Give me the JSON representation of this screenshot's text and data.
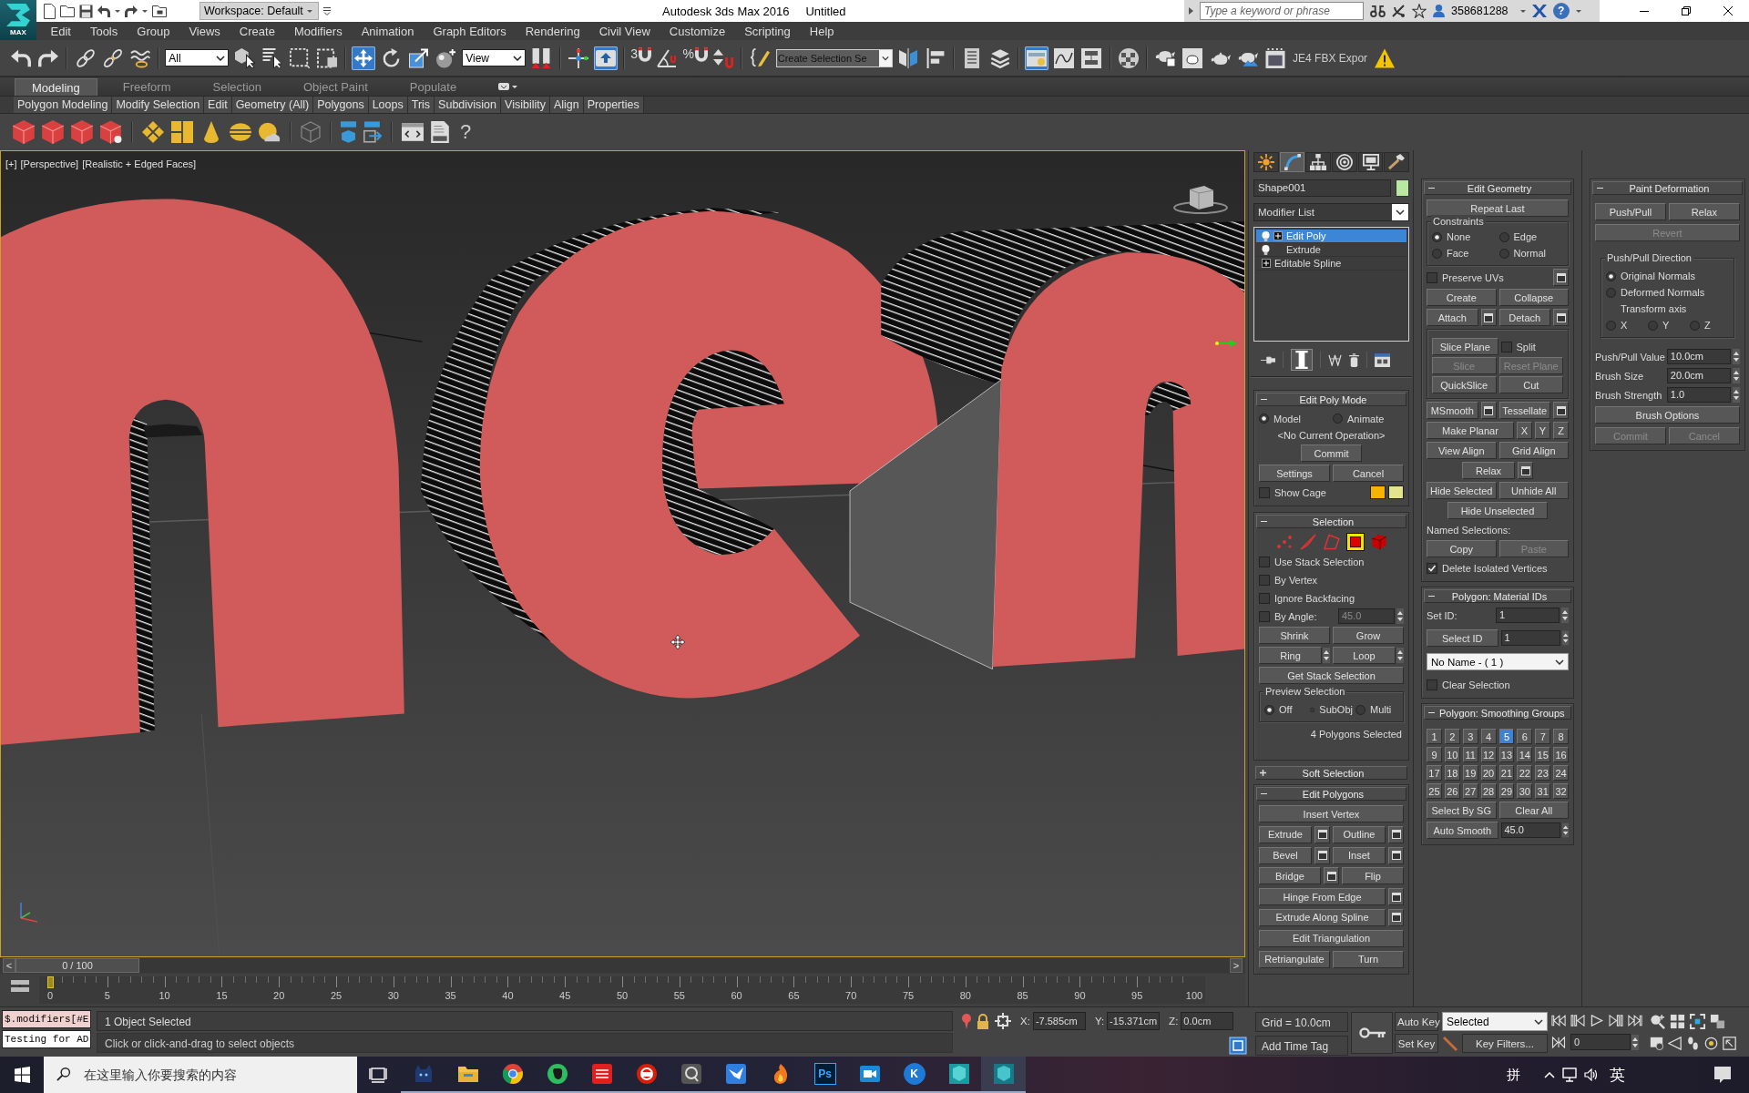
{
  "title_bar": {
    "app_button": "MAX",
    "workspace": "Workspace: Default",
    "title": "Autodesk 3ds Max 2016",
    "document": "Untitled",
    "search": {
      "placeholder": "Type a keyword or phrase"
    },
    "user": "358681288",
    "help": "?"
  },
  "menu_bar": [
    "Edit",
    "Tools",
    "Group",
    "Views",
    "Create",
    "Modifiers",
    "Animation",
    "Graph Editors",
    "Rendering",
    "Civil View",
    "Customize",
    "Scripting",
    "Help"
  ],
  "main_toolbar": {
    "selection_filter": "All",
    "reference_coordinate_system": "View",
    "snaps_toggle": "3",
    "percent_snap": "%",
    "named_selection_set": {
      "placeholder": "Create Selection Se"
    },
    "plugin": "JE4 FBX Expor",
    "pressed": {
      "select_object": false,
      "select_and_move": true,
      "select_and_rotate": false,
      "select_and_scale": false,
      "keyboard_shortcut_override": true,
      "toggle_ribbon": true
    }
  },
  "ribbon": {
    "tabs": [
      {
        "label": "Modeling",
        "selected": true
      },
      {
        "label": "Freeform",
        "selected": false
      },
      {
        "label": "Selection",
        "selected": false
      },
      {
        "label": "Object Paint",
        "selected": false
      },
      {
        "label": "Populate",
        "selected": false
      }
    ],
    "panels": [
      "Polygon Modeling",
      "Modify Selection",
      "Edit",
      "Geometry (All)",
      "Polygons",
      "Loops",
      "Tris",
      "Subdivision",
      "Visibility",
      "Align",
      "Properties"
    ],
    "help": "?"
  },
  "viewport": {
    "labels": [
      "[+]",
      "[Perspective]",
      "[Realistic + Edged Faces]"
    ],
    "active": true
  },
  "command_panel": {
    "tabs": [
      {
        "selected": false
      },
      {
        "selected": true
      },
      {
        "selected": false
      },
      {
        "selected": false
      },
      {
        "selected": false
      },
      {
        "selected": false
      }
    ],
    "object_name": "Shape001",
    "modifier_list": "Modifier List",
    "stack": [
      {
        "label": "Edit Poly",
        "kind": "modifier",
        "expanded": false,
        "selected": true
      },
      {
        "label": "Extrude",
        "kind": "modifier",
        "selected": false
      },
      {
        "label": "Editable Spline",
        "kind": "base",
        "expanded": false,
        "selected": false
      }
    ],
    "show_end_result": true,
    "columns": [
      [
        {
          "title": "Edit Poly Mode",
          "expanded": true,
          "rows": [
            [
              {
                "kind": "radio",
                "label": "Model",
                "selected": true
              },
              {
                "kind": "radio",
                "label": "Animate",
                "selected": false
              }
            ],
            [
              {
                "kind": "note",
                "text": "<No Current Operation>"
              }
            ],
            [
              {
                "kind": "short_button",
                "label": "Commit",
                "disabled": false
              }
            ],
            [
              {
                "kind": "button",
                "label": "Settings",
                "disabled": false
              },
              {
                "kind": "button",
                "label": "Cancel",
                "disabled": false
              }
            ],
            [
              {
                "kind": "checkbox",
                "label": "Show Cage",
                "checked": false
              },
              {
                "kind": "swatch",
                "color": "#f5b400"
              },
              {
                "kind": "swatch",
                "color": "#e3e48e"
              }
            ]
          ]
        },
        {
          "title": "Selection",
          "expanded": true,
          "rows": [
            [
              {
                "kind": "subobject",
                "selected": false
              },
              {
                "kind": "subobject",
                "selected": false
              },
              {
                "kind": "subobject",
                "selected": false
              },
              {
                "kind": "subobject",
                "selected": true
              },
              {
                "kind": "subobject",
                "selected": false
              }
            ],
            [
              {
                "kind": "checkbox",
                "label": "Use Stack Selection",
                "checked": false
              }
            ],
            [
              {
                "kind": "checkbox",
                "label": "By Vertex",
                "checked": false
              }
            ],
            [
              {
                "kind": "checkbox",
                "label": "Ignore Backfacing",
                "checked": false
              }
            ],
            [
              {
                "kind": "checkbox",
                "label": "By Angle:",
                "checked": false,
                "value": "45.0",
                "disabled": true
              }
            ],
            [
              {
                "kind": "button",
                "label": "Shrink",
                "disabled": false
              },
              {
                "kind": "button",
                "label": "Grow",
                "disabled": false
              }
            ],
            [
              {
                "kind": "stepper",
                "label": "Ring",
                "disabled": false
              },
              {
                "kind": "stepper",
                "label": "Loop",
                "disabled": false
              }
            ],
            [
              {
                "kind": "button",
                "label": "Get Stack Selection",
                "disabled": false
              }
            ],
            [
              {
                "kind": "group",
                "title": "Preview Selection",
                "rows": [
                  [
                    {
                      "kind": "radio",
                      "label": "Off",
                      "selected": true
                    },
                    {
                      "kind": "radio",
                      "label": "SubObj",
                      "selected": false
                    },
                    {
                      "kind": "radio",
                      "label": "Multi",
                      "selected": false
                    }
                  ]
                ]
              }
            ],
            [
              {
                "kind": "status",
                "text": "4 Polygons Selected"
              }
            ]
          ]
        },
        {
          "title": "Soft Selection",
          "expanded": false
        },
        {
          "title": "Edit Polygons",
          "expanded": true,
          "rows": [
            [
              {
                "kind": "button",
                "label": "Insert Vertex",
                "disabled": false
              }
            ],
            [
              {
                "kind": "button",
                "label": "Extrude",
                "disabled": false
              },
              {
                "kind": "settings",
                "disabled": false
              },
              {
                "kind": "button",
                "label": "Outline",
                "disabled": false
              },
              {
                "kind": "settings",
                "disabled": false
              }
            ],
            [
              {
                "kind": "button",
                "label": "Bevel",
                "disabled": false
              },
              {
                "kind": "settings",
                "disabled": false
              },
              {
                "kind": "button",
                "label": "Inset",
                "disabled": false
              },
              {
                "kind": "settings",
                "disabled": false
              }
            ],
            [
              {
                "kind": "button",
                "label": "Bridge",
                "disabled": false
              },
              {
                "kind": "settings",
                "disabled": false
              },
              {
                "kind": "button",
                "label": "Flip",
                "disabled": false
              }
            ],
            [
              {
                "kind": "button",
                "label": "Hinge From Edge",
                "disabled": false
              },
              {
                "kind": "settings",
                "disabled": false
              }
            ],
            [
              {
                "kind": "button",
                "label": "Extrude Along Spline",
                "disabled": false
              },
              {
                "kind": "settings",
                "disabled": false
              }
            ],
            [
              {
                "kind": "button",
                "label": "Edit Triangulation",
                "disabled": false
              }
            ],
            [
              {
                "kind": "button",
                "label": "Retriangulate",
                "disabled": false
              },
              {
                "kind": "button",
                "label": "Turn",
                "disabled": false
              }
            ]
          ]
        }
      ],
      [
        {
          "title": "Edit Geometry",
          "expanded": true,
          "rows": [
            [
              {
                "kind": "button",
                "label": "Repeat Last",
                "disabled": false
              }
            ],
            [
              {
                "kind": "group",
                "title": "Constraints",
                "rows": [
                  [
                    {
                      "kind": "radio",
                      "label": "None",
                      "selected": true
                    },
                    {
                      "kind": "radio",
                      "label": "Edge",
                      "selected": false
                    }
                  ],
                  [
                    {
                      "kind": "radio",
                      "label": "Face",
                      "selected": false
                    },
                    {
                      "kind": "radio",
                      "label": "Normal",
                      "selected": false
                    }
                  ]
                ]
              }
            ],
            [
              {
                "kind": "checkbox",
                "label": "Preserve UVs",
                "checked": false
              },
              {
                "kind": "settings",
                "disabled": false
              }
            ],
            [
              {
                "kind": "button",
                "label": "Create",
                "disabled": false
              },
              {
                "kind": "button",
                "label": "Collapse",
                "disabled": false
              }
            ],
            [
              {
                "kind": "button",
                "label": "Attach",
                "disabled": false
              },
              {
                "kind": "settings",
                "disabled": false
              },
              {
                "kind": "button",
                "label": "Detach",
                "disabled": false
              },
              {
                "kind": "settings",
                "disabled": false
              }
            ],
            [
              {
                "kind": "group",
                "rows": [
                  [
                    {
                      "kind": "button",
                      "label": "Slice Plane",
                      "disabled": false
                    },
                    {
                      "kind": "checkbox",
                      "label": "Split",
                      "checked": false
                    }
                  ],
                  [
                    {
                      "kind": "button",
                      "label": "Slice",
                      "disabled": true
                    },
                    {
                      "kind": "button",
                      "label": "Reset Plane",
                      "disabled": true
                    }
                  ],
                  [
                    {
                      "kind": "button",
                      "label": "QuickSlice",
                      "disabled": false
                    },
                    {
                      "kind": "button",
                      "label": "Cut",
                      "disabled": false
                    }
                  ]
                ]
              }
            ],
            [
              {
                "kind": "button",
                "label": "MSmooth",
                "disabled": false
              },
              {
                "kind": "settings",
                "disabled": false
              },
              {
                "kind": "button",
                "label": "Tessellate",
                "disabled": false
              },
              {
                "kind": "settings",
                "disabled": false
              }
            ],
            [
              {
                "kind": "button",
                "label": "Make Planar",
                "disabled": false
              },
              {
                "kind": "small_button",
                "label": "X",
                "disabled": false
              },
              {
                "kind": "small_button",
                "label": "Y",
                "disabled": false
              },
              {
                "kind": "small_button",
                "label": "Z",
                "disabled": false
              }
            ],
            [
              {
                "kind": "button",
                "label": "View Align",
                "disabled": false
              },
              {
                "kind": "button",
                "label": "Grid Align",
                "disabled": false
              }
            ],
            [
              {
                "kind": "short_button",
                "label": "Relax",
                "disabled": false
              },
              {
                "kind": "settings",
                "disabled": false
              }
            ],
            [
              {
                "kind": "button",
                "label": "Hide Selected",
                "disabled": false
              },
              {
                "kind": "button",
                "label": "Unhide All",
                "disabled": false
              }
            ],
            [
              {
                "kind": "short_button",
                "label": "Hide Unselected",
                "disabled": false
              }
            ],
            [
              {
                "kind": "caption",
                "text": "Named Selections:"
              }
            ],
            [
              {
                "kind": "button",
                "label": "Copy",
                "disabled": false
              },
              {
                "kind": "button",
                "label": "Paste",
                "disabled": true
              }
            ],
            [
              {
                "kind": "checkbox",
                "label": "Delete Isolated Vertices",
                "checked": true
              }
            ]
          ]
        },
        {
          "title": "Polygon: Material IDs",
          "expanded": true,
          "rows": [
            [
              {
                "kind": "spinner",
                "label": "Set ID:",
                "value": "1",
                "disabled": false
              }
            ],
            [
              {
                "kind": "button",
                "label": "Select ID",
                "disabled": false
              },
              {
                "kind": "spinner",
                "value": "1",
                "disabled": false
              }
            ],
            [
              {
                "kind": "dropdown",
                "value": "No Name - ( 1 )"
              }
            ],
            [
              {
                "kind": "checkbox",
                "label": "Clear Selection",
                "checked": false
              }
            ]
          ]
        },
        {
          "title": "Polygon: Smoothing Groups",
          "expanded": true,
          "rows": [
            [
              {
                "kind": "toggle",
                "label": "1",
                "selected": false
              },
              {
                "kind": "toggle",
                "label": "2",
                "selected": false
              },
              {
                "kind": "toggle",
                "label": "3",
                "selected": false
              },
              {
                "kind": "toggle",
                "label": "4",
                "selected": false
              },
              {
                "kind": "toggle",
                "label": "5",
                "selected": true
              },
              {
                "kind": "toggle",
                "label": "6",
                "selected": false
              },
              {
                "kind": "toggle",
                "label": "7",
                "selected": false
              },
              {
                "kind": "toggle",
                "label": "8",
                "selected": false
              }
            ],
            [
              {
                "kind": "toggle",
                "label": "9",
                "selected": false
              },
              {
                "kind": "toggle",
                "label": "10",
                "selected": false
              },
              {
                "kind": "toggle",
                "label": "11",
                "selected": false
              },
              {
                "kind": "toggle",
                "label": "12",
                "selected": false
              },
              {
                "kind": "toggle",
                "label": "13",
                "selected": false
              },
              {
                "kind": "toggle",
                "label": "14",
                "selected": false
              },
              {
                "kind": "toggle",
                "label": "15",
                "selected": false
              },
              {
                "kind": "toggle",
                "label": "16",
                "selected": false
              }
            ],
            [
              {
                "kind": "toggle",
                "label": "17",
                "selected": false
              },
              {
                "kind": "toggle",
                "label": "18",
                "selected": false
              },
              {
                "kind": "toggle",
                "label": "19",
                "selected": false
              },
              {
                "kind": "toggle",
                "label": "20",
                "selected": false
              },
              {
                "kind": "toggle",
                "label": "21",
                "selected": false
              },
              {
                "kind": "toggle",
                "label": "22",
                "selected": false
              },
              {
                "kind": "toggle",
                "label": "23",
                "selected": false
              },
              {
                "kind": "toggle",
                "label": "24",
                "selected": false
              }
            ],
            [
              {
                "kind": "toggle",
                "label": "25",
                "selected": false
              },
              {
                "kind": "toggle",
                "label": "26",
                "selected": false
              },
              {
                "kind": "toggle",
                "label": "27",
                "selected": false
              },
              {
                "kind": "toggle",
                "label": "28",
                "selected": false
              },
              {
                "kind": "toggle",
                "label": "29",
                "selected": false
              },
              {
                "kind": "toggle",
                "label": "30",
                "selected": false
              },
              {
                "kind": "toggle",
                "label": "31",
                "selected": false
              },
              {
                "kind": "toggle",
                "label": "32",
                "selected": false
              }
            ],
            [
              {
                "kind": "button",
                "label": "Select By SG",
                "disabled": false
              },
              {
                "kind": "button",
                "label": "Clear All",
                "disabled": false
              }
            ],
            [
              {
                "kind": "button",
                "label": "Auto Smooth",
                "disabled": false
              },
              {
                "kind": "spinner",
                "value": "45.0",
                "disabled": false
              }
            ]
          ]
        }
      ],
      [
        {
          "title": "Paint Deformation",
          "expanded": true,
          "rows": [
            [
              {
                "kind": "button",
                "label": "Push/Pull",
                "disabled": false
              },
              {
                "kind": "button",
                "label": "Relax",
                "disabled": false
              }
            ],
            [
              {
                "kind": "button",
                "label": "Revert",
                "disabled": true
              }
            ],
            [
              {
                "kind": "group",
                "title": "Push/Pull Direction",
                "rows": [
                  [
                    {
                      "kind": "radio",
                      "label": "Original Normals",
                      "selected": true
                    }
                  ],
                  [
                    {
                      "kind": "radio",
                      "label": "Deformed Normals",
                      "selected": false
                    }
                  ],
                  [
                    {
                      "kind": "caption",
                      "text": "Transform axis"
                    }
                  ],
                  [
                    {
                      "kind": "radio",
                      "label": "X",
                      "selected": false
                    },
                    {
                      "kind": "radio",
                      "label": "Y",
                      "selected": false
                    },
                    {
                      "kind": "radio",
                      "label": "Z",
                      "selected": false
                    }
                  ]
                ]
              }
            ],
            [
              {
                "kind": "spinner",
                "label": "Push/Pull Value",
                "value": "10.0cm",
                "disabled": false
              }
            ],
            [
              {
                "kind": "spinner",
                "label": "Brush Size",
                "value": "20.0cm",
                "disabled": false
              }
            ],
            [
              {
                "kind": "spinner",
                "label": "Brush Strength",
                "value": "1.0",
                "disabled": false
              }
            ],
            [
              {
                "kind": "button",
                "label": "Brush Options",
                "disabled": false
              }
            ],
            [
              {
                "kind": "button",
                "label": "Commit",
                "disabled": true
              },
              {
                "kind": "button",
                "label": "Cancel",
                "disabled": true
              }
            ]
          ]
        }
      ]
    ]
  },
  "time_slider": {
    "prev": "<",
    "label": "0 / 100",
    "next": ">",
    "level": 0
  },
  "track_bar": {
    "labels": [
      "0",
      "5",
      "10",
      "15",
      "20",
      "25",
      "30",
      "35",
      "40",
      "45",
      "50",
      "55",
      "60",
      "65",
      "70",
      "75",
      "80",
      "85",
      "90",
      "95",
      "100"
    ]
  },
  "status_bar": {
    "listener_output": "$.modifiers[#E",
    "listener_input": "Testing for AD",
    "selection_info": "1 Object Selected",
    "prompt": "Click or click-and-drag to select objects",
    "coordinates": [
      {
        "label": "X:",
        "value": "-7.585cm"
      },
      {
        "label": "Y:",
        "value": "-15.371cm"
      },
      {
        "label": "Z:",
        "value": "0.0cm"
      }
    ],
    "grid": "Grid = 10.0cm",
    "time_tag": "Add Time Tag"
  },
  "animation_controls": {
    "auto_key": {
      "label": "Auto Key",
      "on": false
    },
    "set_key": "Set Key",
    "key_mode": "Selected",
    "key_filters": "Key Filters...",
    "current_frame": "0"
  },
  "taskbar": {
    "search": {
      "placeholder": "在这里输入你要搜索的内容"
    },
    "apps": [
      {
        "running": true,
        "selected": false
      },
      {
        "running": true,
        "selected": false
      },
      {
        "running": true,
        "selected": false
      },
      {
        "running": true,
        "selected": false
      },
      {
        "running": true,
        "selected": false
      },
      {
        "running": true,
        "selected": false
      },
      {
        "running": true,
        "selected": false
      },
      {
        "running": true,
        "selected": false
      },
      {
        "running": true,
        "selected": false
      },
      {
        "running": true,
        "selected": false,
        "label": "Ps"
      },
      {
        "running": true,
        "selected": false
      },
      {
        "running": true,
        "selected": false,
        "label": "K"
      },
      {
        "running": true,
        "selected": false
      },
      {
        "running": true,
        "selected": true
      }
    ],
    "tray": {
      "input_method": "拼",
      "language": "英"
    }
  }
}
